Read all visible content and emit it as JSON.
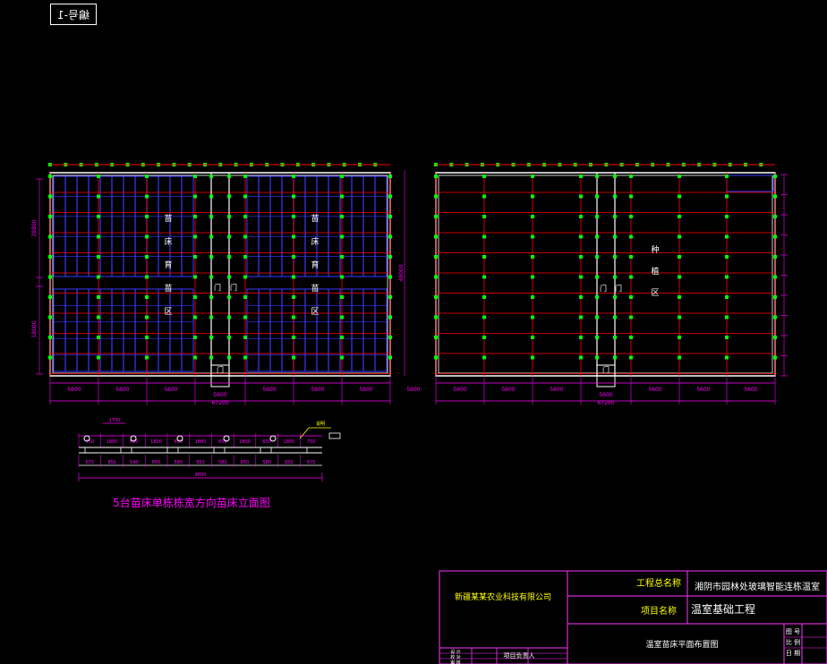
{
  "drawing_tag": "编号-1",
  "plan_left": {
    "zone_label_chars": [
      "苗",
      "床",
      "育",
      "苗",
      "区"
    ],
    "door_label": "门",
    "bay_dims": [
      "5600",
      "5600",
      "5600",
      "5600",
      "5600",
      "5600"
    ],
    "middle_dim": "5600",
    "total_width": "67200",
    "left_dims": [
      "28800",
      "18000"
    ],
    "right_dim": "48000"
  },
  "plan_right": {
    "zone_label_chars": [
      "种",
      "植",
      "区"
    ],
    "door_label": "门",
    "bay_dims": [
      "5600",
      "5600",
      "5600",
      "5600",
      "5600",
      "5600"
    ],
    "middle_dim": "5600",
    "total_width": "67200"
  },
  "elevation": {
    "title": "5台苗床单栋栋宽方向苗床立面图",
    "top_dims": [
      "1700",
      "750",
      "1800",
      "650",
      "1800",
      "650",
      "1800",
      "650",
      "1800",
      "650",
      "1800",
      "750"
    ],
    "bottom_dims": [
      "675",
      "850",
      "540",
      "850",
      "580",
      "850",
      "580",
      "850",
      "580",
      "850",
      "675"
    ],
    "total": "9600",
    "callout": "说明"
  },
  "title_block": {
    "company": "新疆某某农业科技有限公司",
    "project_label": "工程总名称",
    "project_value": "湘阴市园林处玻璃智能连栋温室",
    "item_label": "项目名称",
    "item_value": "温室基础工程",
    "drawing_name": "温室苗床平面布置图",
    "person_label": "项目负责人",
    "rows": [
      "设 计",
      "校 对",
      "审 核"
    ],
    "right_rows": [
      "图 号",
      "比 例",
      "日 期"
    ]
  },
  "colors": {
    "frame": "#ffffff",
    "grid_red": "#ff0000",
    "bed_blue": "#3a3aff",
    "node_green": "#00ff00",
    "dim_magenta": "#ff00ff",
    "text_yellow": "#ffff00",
    "title_magenta": "#ff33ff"
  }
}
